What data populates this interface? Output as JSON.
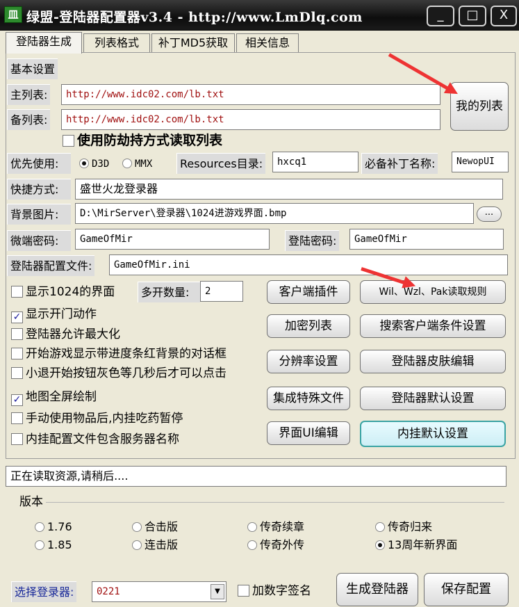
{
  "window": {
    "icon_text": "皿",
    "title": "绿盟-登陆器配置器v3.4 - http://www.LmDlq.com",
    "minimize": "_",
    "maximize": "□",
    "close": "X"
  },
  "tabs": [
    "登陆器生成",
    "列表格式",
    "补丁MD5获取",
    "相关信息"
  ],
  "basic": {
    "section_label": "基本设置",
    "main_list_label": "主列表:",
    "main_list_value": "http://www.idc02.com/lb.txt",
    "backup_list_label": "备列表:",
    "backup_list_value": "http://www.idc02.com/lb.txt",
    "my_list_button": "我的列表",
    "anti_hijack_label": "使用防劫持方式读取列表",
    "priority_label": "优先使用:",
    "priority_d3d": "D3D",
    "priority_mmx": "MMX",
    "resources_label": "Resources目录:",
    "resources_value": "hxcq1",
    "patch_name_label": "必备补丁名称:",
    "patch_name_value": "NewopUI",
    "shortcut_label": "快捷方式:",
    "shortcut_value": "盛世火龙登录器",
    "bg_image_label": "背景图片:",
    "bg_image_value": "D:\\MirServer\\登录器\\1024进游戏界面.bmp",
    "browse_button": "...",
    "client_pwd_label": "微端密码:",
    "client_pwd_value": "GameOfMir",
    "login_pwd_label": "登陆密码:",
    "login_pwd_value": "GameOfMir",
    "config_file_label": "登陆器配置文件:",
    "config_file_value": "GameOfMir.ini"
  },
  "options": {
    "show_1024": "显示1024的界面",
    "multi_open_label": "多开数量:",
    "multi_open_value": "2",
    "show_door_anim": "显示开门动作",
    "allow_maximize": "登陆器允许最大化",
    "progress_bar_bg": "开始游戏显示带进度条红背景的对话框",
    "retreat_gray": "小退开始按钮灰色等几秒后才可以点击",
    "map_fullscreen": "地图全屏绘制",
    "pause_after_item": "手动使用物品后,内挂吃药暂停",
    "config_server_name": "内挂配置文件包含服务器名称"
  },
  "buttons": {
    "client_plugin": "客户端插件",
    "wil_rules": "Wil、Wzl、Pak读取规则",
    "encrypt_list": "加密列表",
    "search_client": "搜索客户端条件设置",
    "resolution": "分辨率设置",
    "skin_edit": "登陆器皮肤编辑",
    "special_files": "集成特殊文件",
    "default_settings": "登陆器默认设置",
    "ui_edit": "界面UI编辑",
    "plugin_defaults": "内挂默认设置"
  },
  "status_text": "正在读取资源,请稍后....",
  "version": {
    "title": "版本",
    "options": [
      "1.76",
      "合击版",
      "传奇续章",
      "传奇归来",
      "1.85",
      "连击版",
      "传奇外传",
      "13周年新界面"
    ],
    "selected": "13周年新界面"
  },
  "bottom": {
    "select_label": "选择登录器:",
    "select_value": "0221",
    "digital_sign": "加数字签名",
    "generate_button": "生成登陆器",
    "save_button": "保存配置"
  },
  "colors": {
    "annotation_arrow": "#e33333",
    "highlight_border": "#3aa3a3"
  }
}
